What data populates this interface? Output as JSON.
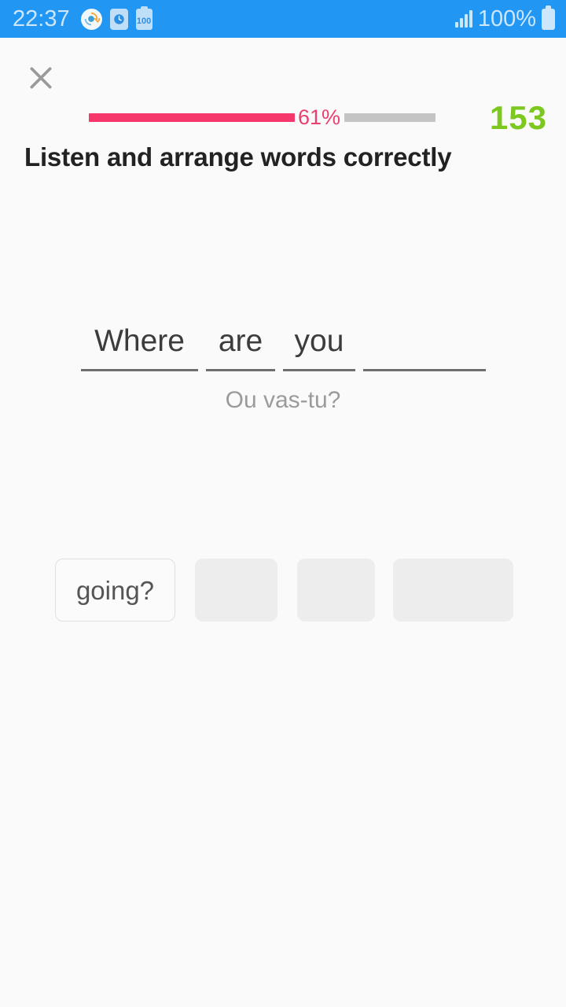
{
  "statusbar": {
    "time": "22:37",
    "battery_percent": "100%",
    "battery_level_badge": "100",
    "icons": [
      "sync-icon",
      "alarm-icon",
      "battery-saver-icon",
      "signal-icon",
      "battery-icon"
    ],
    "bg_color": "#2196F3",
    "text_color": "#CCE7FB"
  },
  "topbar": {
    "close_icon": "close-icon",
    "progress": {
      "percent_label": "61%",
      "percent_value": 61,
      "fill_color": "#F5376C",
      "track_color": "#C4C4C4"
    },
    "score": "153",
    "score_color": "#7CC81E"
  },
  "exercise": {
    "prompt": "Listen and arrange words correctly",
    "translation": "Ou vas-tu?",
    "answer_slots": [
      {
        "text": "Where",
        "filled": true
      },
      {
        "text": "are",
        "filled": true
      },
      {
        "text": "you",
        "filled": true
      },
      {
        "text": "",
        "filled": false
      }
    ],
    "word_bank": [
      {
        "text": "going?",
        "used": false
      },
      {
        "text": "",
        "used": true
      },
      {
        "text": "",
        "used": true
      },
      {
        "text": "",
        "used": true
      }
    ]
  }
}
